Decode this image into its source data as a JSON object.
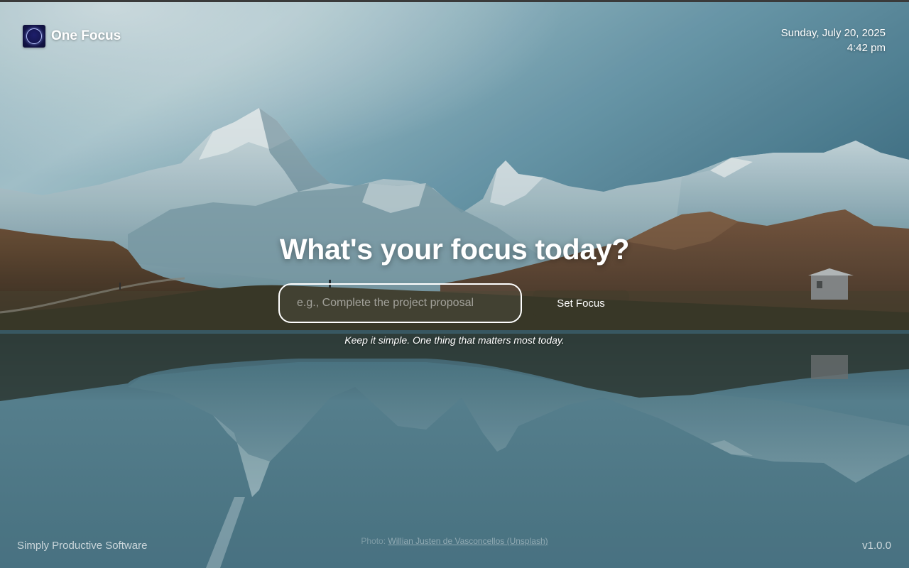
{
  "brand": {
    "name": "One Focus",
    "logo_icon": "ring-icon"
  },
  "datetime": {
    "date": "Sunday, July 20, 2025",
    "time": "4:42 pm"
  },
  "main": {
    "heading": "What's your focus today?",
    "input_placeholder": "e.g., Complete the project proposal",
    "input_value": "",
    "button_label": "Set Focus",
    "hint": "Keep it simple. One thing that matters most today."
  },
  "footer": {
    "company": "Simply Productive Software",
    "photo_prefix": "Photo:",
    "photo_credit": "Willian Justen de Vasconcellos (Unsplash)",
    "version": "v1.0.0"
  },
  "colors": {
    "sky_top": "#5e8fa0",
    "water": "#4f7f8f",
    "text": "#ffffff"
  }
}
